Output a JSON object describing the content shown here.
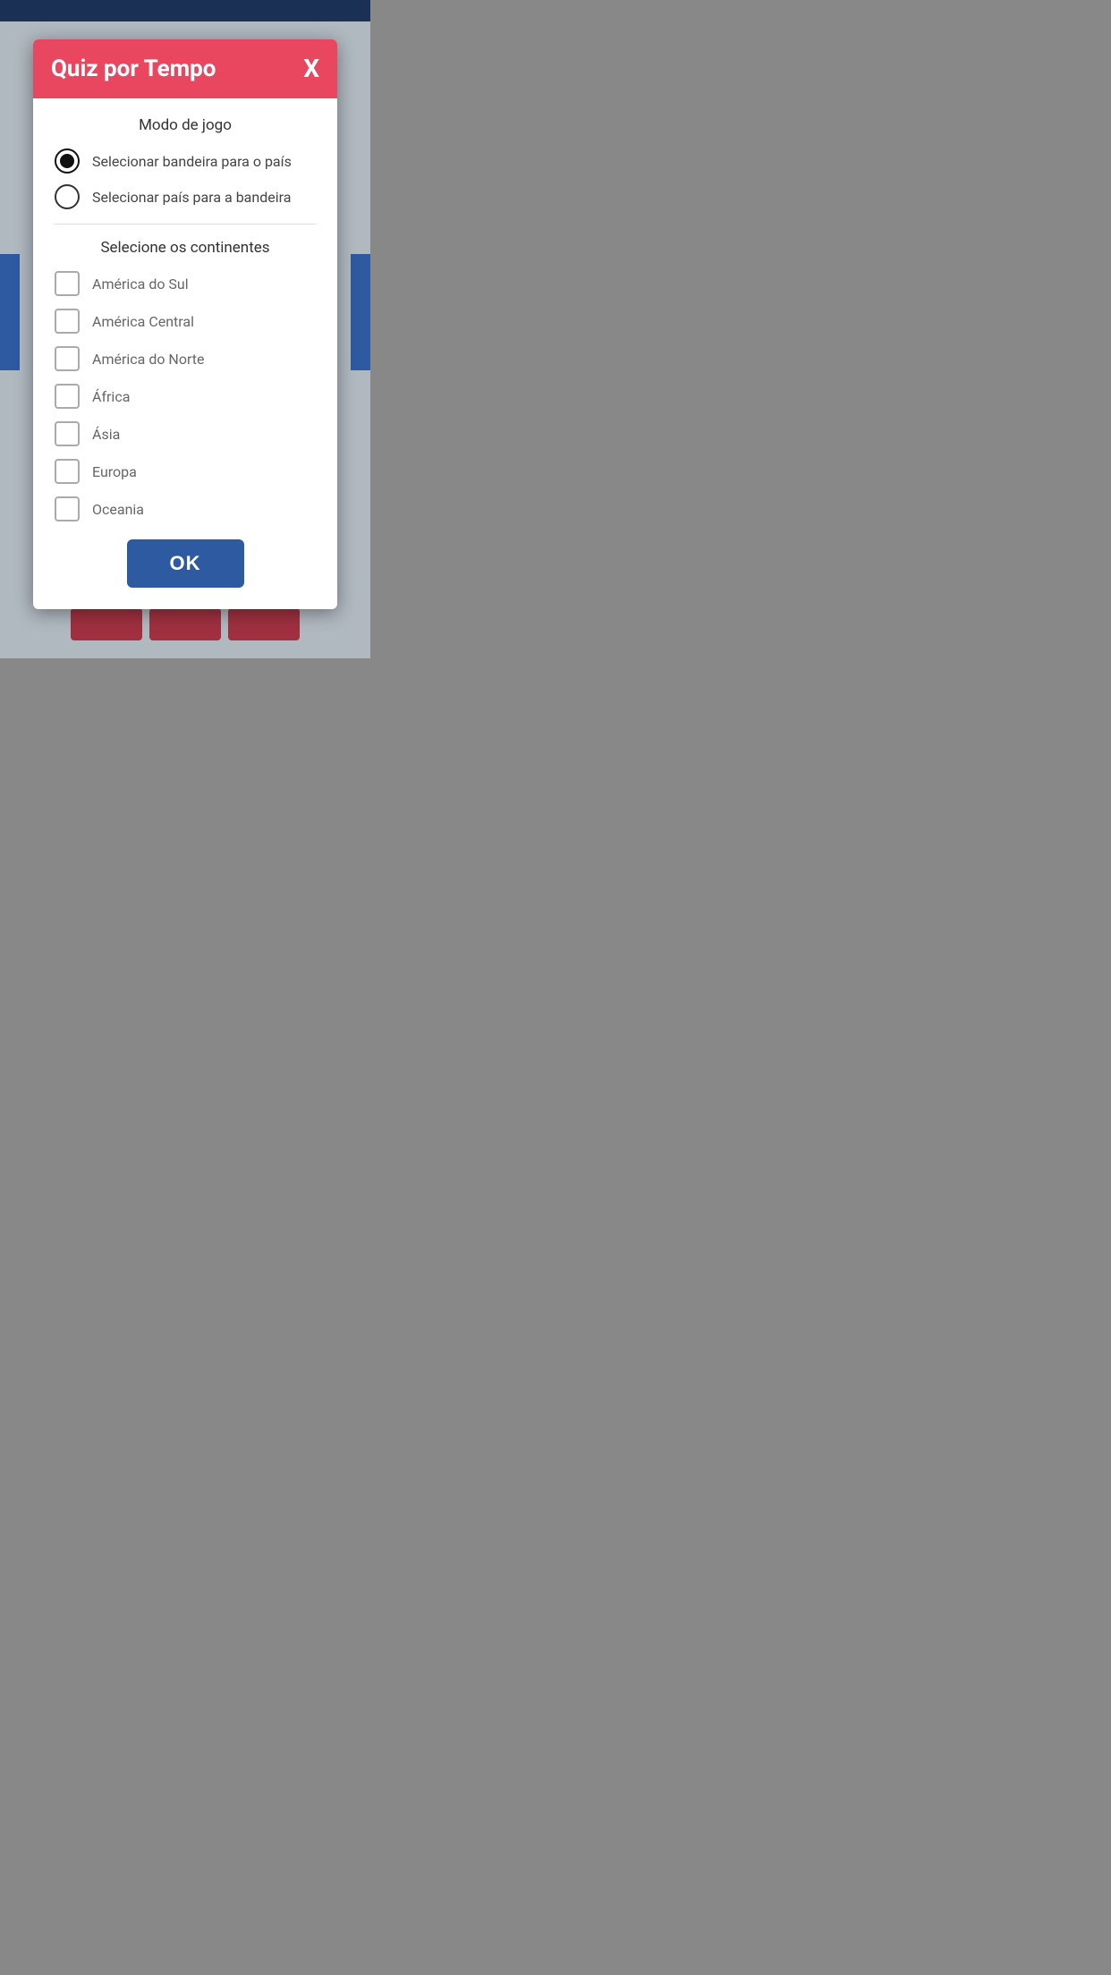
{
  "statusBar": {
    "color": "#1a3055"
  },
  "modal": {
    "title": "Quiz por Tempo",
    "closeLabel": "X",
    "gameModeSection": {
      "sectionTitle": "Modo de jogo",
      "radioOptions": [
        {
          "label": "Selecionar bandeira para o país",
          "checked": true,
          "id": "radio-flag-for-country"
        },
        {
          "label": "Selecionar país para a bandeira",
          "checked": false,
          "id": "radio-country-for-flag"
        }
      ]
    },
    "continentsSection": {
      "sectionTitle": "Selecione os continentes",
      "checkboxOptions": [
        {
          "label": "América do Sul",
          "checked": false
        },
        {
          "label": "América Central",
          "checked": false
        },
        {
          "label": "América do Norte",
          "checked": false
        },
        {
          "label": "África",
          "checked": false
        },
        {
          "label": "Ásia",
          "checked": false
        },
        {
          "label": "Europa",
          "checked": false
        },
        {
          "label": "Oceania",
          "checked": false
        }
      ]
    },
    "okButtonLabel": "OK"
  }
}
